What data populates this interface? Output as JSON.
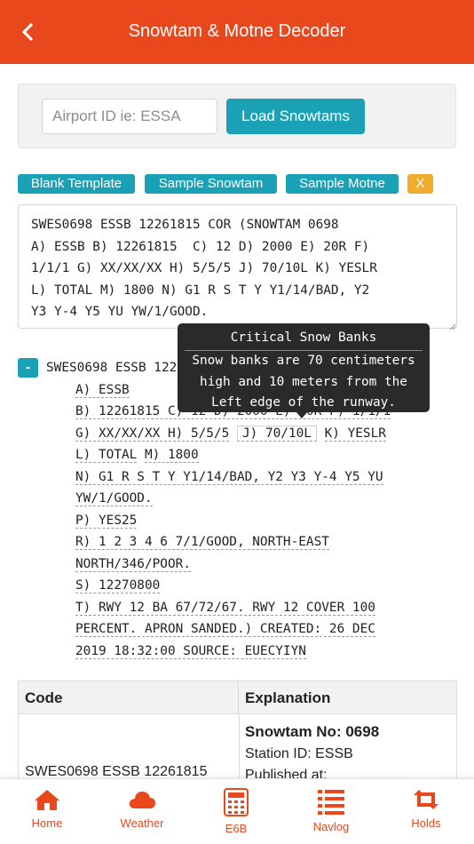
{
  "header": {
    "title": "Snowtam & Motne Decoder",
    "back_icon": "chevron-left-icon"
  },
  "load": {
    "placeholder": "Airport ID ie: ESSA",
    "value": "",
    "button_label": "Load Snowtams"
  },
  "templates": {
    "blank": "Blank Template",
    "sample_snowtam": "Sample Snowtam",
    "sample_motne": "Sample Motne",
    "clear": "X"
  },
  "message_text": "SWES0698 ESSB 12261815 COR (SNOWTAM 0698\nA) ESSB B) 12261815  C) 12 D) 2000 E) 20R F)\n1/1/1 G) XX/XX/XX H) 5/5/5 J) 70/10L K) YESLR\nL) TOTAL M) 1800 N) G1 R S T Y Y1/14/BAD, Y2\nY3 Y-4 Y5 YU YW/1/GOOD.\nP) YES25 R) 1 2 3 4 6 7/1/GOOD, NORTH-EAST",
  "decoded": {
    "collapse_label": "-",
    "header": "SWES0698 ESSB 12261815 COR (SNOWTAM 0698",
    "line_a": "A) ESSB",
    "line_b_pre": "B) 12261815 C) 12 D) 2000 E) 20R F) 1/1/1",
    "line_g_pre": "G) XX/XX/XX H) 5/5/5",
    "line_j": "J) 70/10L",
    "line_k": "K) YESLR",
    "line_l": "L) TOTAL",
    "line_m": "M) 1800",
    "line_n1": "N) G1 R S T Y Y1/14/BAD, Y2 Y3 Y-4 Y5 YU",
    "line_n2": "YW/1/GOOD.",
    "line_p": "P) YES25",
    "line_r1": "R) 1 2 3 4 6 7/1/GOOD, NORTH-EAST",
    "line_r2": "NORTH/346/POOR.",
    "line_s": "S) 12270800",
    "line_t1": "T) RWY 12 BA 67/72/67. RWY 12 COVER 100",
    "line_t2": "PERCENT. APRON SANDED.) CREATED: 26 DEC",
    "line_t3": "2019 18:32:00 SOURCE: EUECYIYN"
  },
  "tooltip": {
    "title": "Critical Snow Banks",
    "line1": "Snow banks are 70 centimeters",
    "line2": "high and 10 meters from the",
    "line3": "Left edge of the runway."
  },
  "table": {
    "headers": [
      "Code",
      "Explanation"
    ],
    "row": {
      "code": "SWES0698 ESSB 12261815",
      "explanation_title": "Snowtam No: 0698",
      "explanation_line2": "Station ID: ESSB",
      "explanation_line3": "Published at:"
    }
  },
  "tabs": [
    {
      "label": "Home",
      "icon": "home-icon"
    },
    {
      "label": "Weather",
      "icon": "cloud-icon"
    },
    {
      "label": "E6B",
      "icon": "calculator-icon"
    },
    {
      "label": "Navlog",
      "icon": "list-icon"
    },
    {
      "label": "Holds",
      "icon": "retweet-icon"
    }
  ],
  "colors": {
    "brand": "#e8481c",
    "accent": "#1ba1b5",
    "warning": "#f0ad2d"
  }
}
